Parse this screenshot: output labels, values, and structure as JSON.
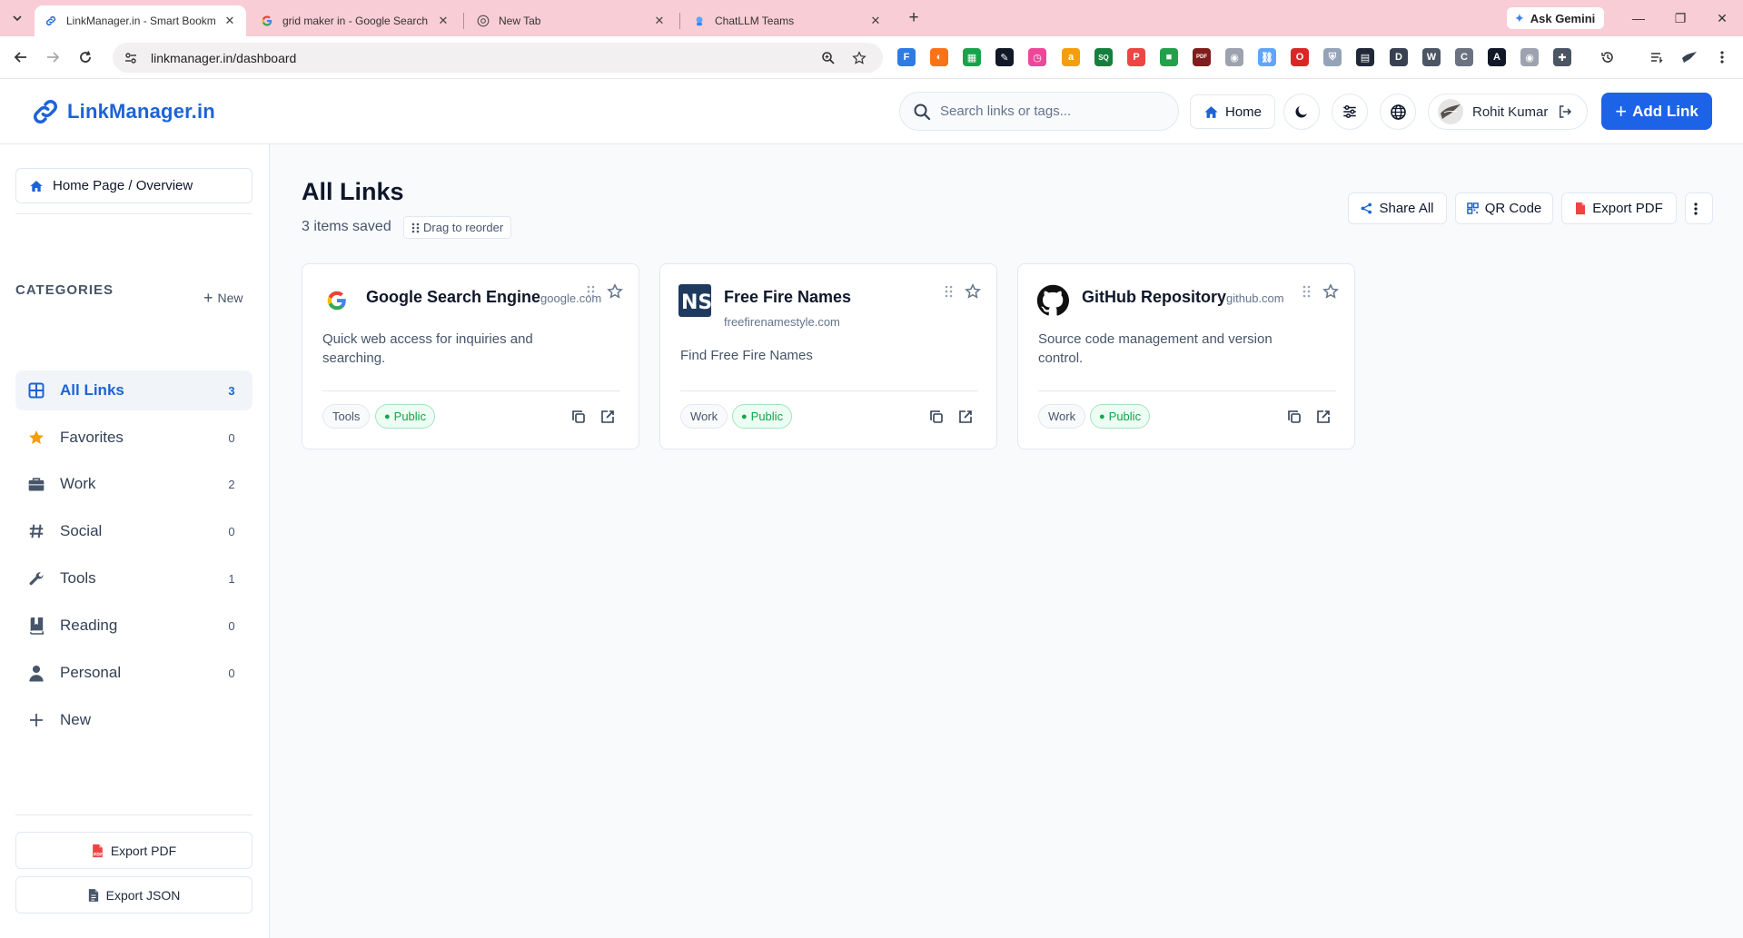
{
  "browser": {
    "tabs": [
      {
        "title": "LinkManager.in - Smart Bookma",
        "active": true
      },
      {
        "title": "grid maker in - Google Search",
        "active": false
      },
      {
        "title": "New Tab",
        "active": false
      },
      {
        "title": "ChatLLM Teams",
        "active": false
      }
    ],
    "gemini_label": "Ask Gemini",
    "url": "linkmanager.in/dashboard",
    "extensions": [
      {
        "icon": "f-extension-icon",
        "glyph": "F",
        "color": "#2d7be5"
      },
      {
        "icon": "color-wheel-extension-icon",
        "glyph": "◐",
        "color": "#f97316"
      },
      {
        "icon": "grid-extension-icon",
        "glyph": "▦",
        "color": "#16a34a"
      },
      {
        "icon": "pen-extension-icon",
        "glyph": "✎",
        "color": "#111827"
      },
      {
        "icon": "clock-extension-icon",
        "glyph": "◷",
        "color": "#ec4899"
      },
      {
        "icon": "amazon-extension-icon",
        "glyph": "a",
        "color": "#f59e0b"
      },
      {
        "icon": "sq-extension-icon",
        "glyph": "SQ",
        "color": "#15803d"
      },
      {
        "icon": "p-extension-icon",
        "glyph": "P",
        "color": "#ef4444"
      },
      {
        "icon": "bot-extension-icon",
        "glyph": "■",
        "color": "#22a04b"
      },
      {
        "icon": "pdf-extension-icon",
        "glyph": "PDF",
        "color": "#7f1d1d"
      },
      {
        "icon": "camera-extension-icon",
        "glyph": "◉",
        "color": "#9ca3af"
      },
      {
        "icon": "link-extension-icon",
        "glyph": "⛓",
        "color": "#60a5fa"
      },
      {
        "icon": "opera-extension-icon",
        "glyph": "O",
        "color": "#dc2626"
      },
      {
        "icon": "shield-extension-icon",
        "glyph": "⛨",
        "color": "#94a3b8"
      },
      {
        "icon": "note-extension-icon",
        "glyph": "▤",
        "color": "#1f2937"
      },
      {
        "icon": "d-extension-icon",
        "glyph": "D",
        "color": "#374151"
      },
      {
        "icon": "w-extension-icon",
        "glyph": "W",
        "color": "#4b5563"
      },
      {
        "icon": "c-extension-icon",
        "glyph": "C",
        "color": "#6b7280"
      },
      {
        "icon": "a-circle-extension-icon",
        "glyph": "A",
        "color": "#111827"
      },
      {
        "icon": "camera2-extension-icon",
        "glyph": "◉",
        "color": "#9ca3af"
      },
      {
        "icon": "puzzle-extension-icon",
        "glyph": "✚",
        "color": "#4b5563"
      }
    ]
  },
  "header": {
    "logo_text": "LinkManager.in",
    "search_placeholder": "Search links or tags...",
    "home_label": "Home",
    "user_name": "Rohit Kumar",
    "add_link_label": "Add Link"
  },
  "sidebar": {
    "overview_label": "Home Page / Overview",
    "categories_title": "CATEGORIES",
    "new_label": "New",
    "categories": [
      {
        "label": "All Links",
        "count": "3",
        "icon": "grid-icon",
        "active": true
      },
      {
        "label": "Favorites",
        "count": "0",
        "icon": "star-icon",
        "active": false
      },
      {
        "label": "Work",
        "count": "2",
        "icon": "briefcase-icon",
        "active": false
      },
      {
        "label": "Social",
        "count": "0",
        "icon": "hashtag-icon",
        "active": false
      },
      {
        "label": "Tools",
        "count": "1",
        "icon": "wrench-icon",
        "active": false
      },
      {
        "label": "Reading",
        "count": "0",
        "icon": "book-icon",
        "active": false
      },
      {
        "label": "Personal",
        "count": "0",
        "icon": "person-icon",
        "active": false
      }
    ],
    "add_category_label": "New",
    "export_pdf_label": "Export PDF",
    "export_json_label": "Export JSON"
  },
  "main": {
    "title": "All Links",
    "item_count": "3 items saved",
    "drag_hint": "Drag to reorder",
    "actions": {
      "share_all": "Share All",
      "qr_code": "QR Code",
      "export_pdf": "Export PDF"
    },
    "cards": [
      {
        "title": "Google Search Engine",
        "domain": "google.com",
        "description": "Quick web access for inquiries and searching.",
        "category_tag": "Tools",
        "visibility": "Public",
        "logo": "google-logo-icon"
      },
      {
        "title": "Free Fire Names",
        "domain": "freefirenamestyle.com",
        "description": "Find Free Fire Names",
        "category_tag": "Work",
        "visibility": "Public",
        "logo": "ns-logo-icon",
        "logo_text": "NS"
      },
      {
        "title": "GitHub Repository",
        "domain": "github.com",
        "description": "Source code management and version control.",
        "category_tag": "Work",
        "visibility": "Public",
        "logo": "github-logo-icon"
      }
    ]
  },
  "colors": {
    "brand": "#1d63d6",
    "primary_button": "#1d63e8",
    "public_green": "#16a34a",
    "tab_strip": "#f9cdd6",
    "favorites_star": "#f59e0b"
  }
}
